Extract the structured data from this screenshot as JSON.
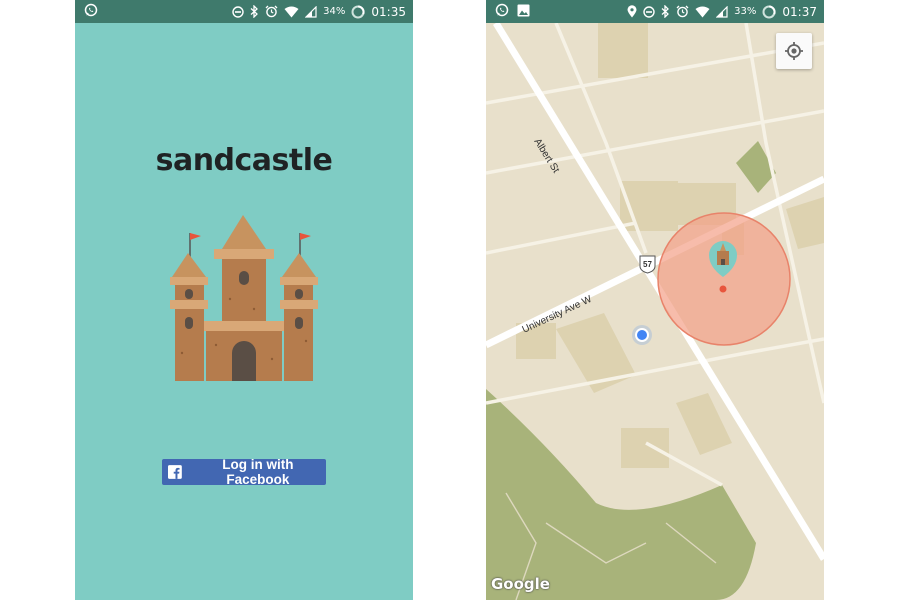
{
  "left_screen": {
    "status_bar": {
      "battery": "34%",
      "time": "01:35"
    },
    "app_title": "sandcastle",
    "login_button_label": "Log in with Facebook"
  },
  "right_screen": {
    "status_bar": {
      "battery": "33%",
      "time": "01:37"
    },
    "map": {
      "street_labels": [
        "Albert St",
        "University Ave W"
      ],
      "route_shield": "57",
      "attribution": "Google"
    }
  },
  "colors": {
    "status_bar": "#3f7a6c",
    "splash_background": "#7fccc4",
    "facebook_blue": "#4267b2",
    "map_land": "#e8e0cb",
    "map_park": "#a8b37a",
    "geofence": "#f4a088",
    "user_location": "#4285f4"
  }
}
